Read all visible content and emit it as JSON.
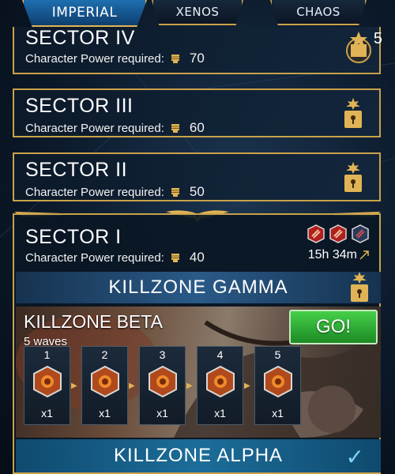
{
  "tabs": [
    {
      "label": "IMPERIAL",
      "active": true
    },
    {
      "label": "XENOS",
      "active": false
    },
    {
      "label": "CHAOS",
      "active": false
    }
  ],
  "sectors": {
    "iv": {
      "title": "SECTOR IV",
      "req_label": "Character Power required:",
      "power": "70",
      "squad_count": "5",
      "icon": "squad-badge-icon"
    },
    "iii": {
      "title": "SECTOR III",
      "req_label": "Character Power required:",
      "power": "60",
      "icon": "lock-icon"
    },
    "ii": {
      "title": "SECTOR II",
      "req_label": "Character Power required:",
      "power": "50",
      "icon": "lock-icon"
    },
    "i": {
      "title": "SECTOR I",
      "req_label": "Character Power required:",
      "power": "40",
      "timer": "15h 34m",
      "medals": [
        "red-medal-icon",
        "red-medal-icon",
        "blue-medal-icon"
      ]
    }
  },
  "killzones": {
    "gamma": {
      "title": "KILLZONE GAMMA",
      "locked": true
    },
    "beta": {
      "title": "KILLZONE BETA",
      "waves_label": "5 waves",
      "go_label": "GO!",
      "waves": [
        {
          "num": "1",
          "count": "x1"
        },
        {
          "num": "2",
          "count": "x1"
        },
        {
          "num": "3",
          "count": "x1"
        },
        {
          "num": "4",
          "count": "x1"
        },
        {
          "num": "5",
          "count": "x1"
        }
      ]
    },
    "alpha": {
      "title": "KILLZONE ALPHA",
      "completed": true
    }
  },
  "colors": {
    "gold_border": "#c9a24b",
    "go_green": "#2fb035",
    "active_tab": "#1e6fb0"
  }
}
